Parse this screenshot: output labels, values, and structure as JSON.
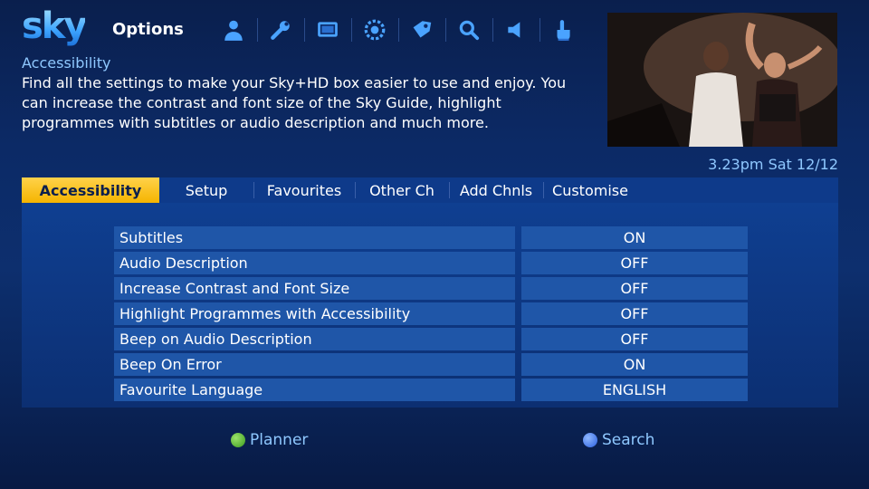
{
  "header": {
    "logo": "sky",
    "title": "Options",
    "icons": [
      "person-icon",
      "wrench-icon",
      "screen-icon",
      "gear-icon",
      "tag-icon",
      "search-icon",
      "speaker-icon",
      "hand-icon"
    ]
  },
  "description": {
    "title": "Accessibility",
    "body": "Find all the settings to make your Sky+HD box easier to use and enjoy. You can increase the contrast and font size of the Sky Guide, highlight programmes with subtitles or audio description and much more."
  },
  "clock": "3.23pm Sat 12/12",
  "tabs": [
    {
      "label": "Accessibility",
      "active": true
    },
    {
      "label": "Setup"
    },
    {
      "label": "Favourites"
    },
    {
      "label": "Other Ch"
    },
    {
      "label": "Add Chnls"
    },
    {
      "label": "Customise"
    }
  ],
  "settings": [
    {
      "label": "Subtitles",
      "value": "ON"
    },
    {
      "label": "Audio Description",
      "value": "OFF"
    },
    {
      "label": "Increase Contrast and Font Size",
      "value": "OFF"
    },
    {
      "label": "Highlight Programmes with Accessibility",
      "value": "OFF"
    },
    {
      "label": "Beep on Audio Description",
      "value": "OFF"
    },
    {
      "label": "Beep On Error",
      "value": "ON"
    },
    {
      "label": "Favourite Language",
      "value": "ENGLISH"
    }
  ],
  "keys": {
    "green": {
      "label": "Planner",
      "color": "#4caf2a"
    },
    "blue": {
      "label": "Search",
      "color": "#3a7bff"
    }
  },
  "colors": {
    "accent": "#f5b400",
    "text_highlight": "#8fc8ff"
  }
}
